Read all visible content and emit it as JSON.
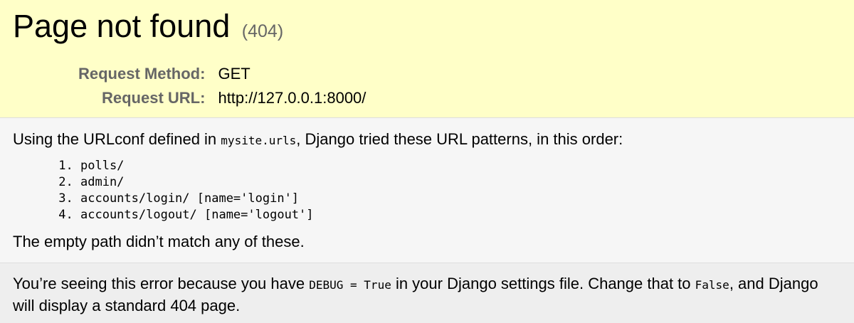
{
  "summary": {
    "title": "Page not found",
    "status_code": "(404)",
    "request_method_label": "Request Method:",
    "request_method": "GET",
    "request_url_label": "Request URL:",
    "request_url": "http://127.0.0.1:8000/"
  },
  "info": {
    "intro_before": "Using the URLconf defined in ",
    "urlconf": "mysite.urls",
    "intro_after": ", Django tried these URL patterns, in this order:",
    "patterns": [
      "polls/",
      "admin/",
      "accounts/login/ [name='login']",
      "accounts/logout/ [name='logout']"
    ],
    "no_match": "The empty path didn’t match any of these."
  },
  "explanation": {
    "before": "You’re seeing this error because you have ",
    "debug_setting": "DEBUG = True",
    "middle": " in your Django settings file. Change that to ",
    "false_value": "False",
    "after": ", and Django will display a standard 404 page."
  }
}
